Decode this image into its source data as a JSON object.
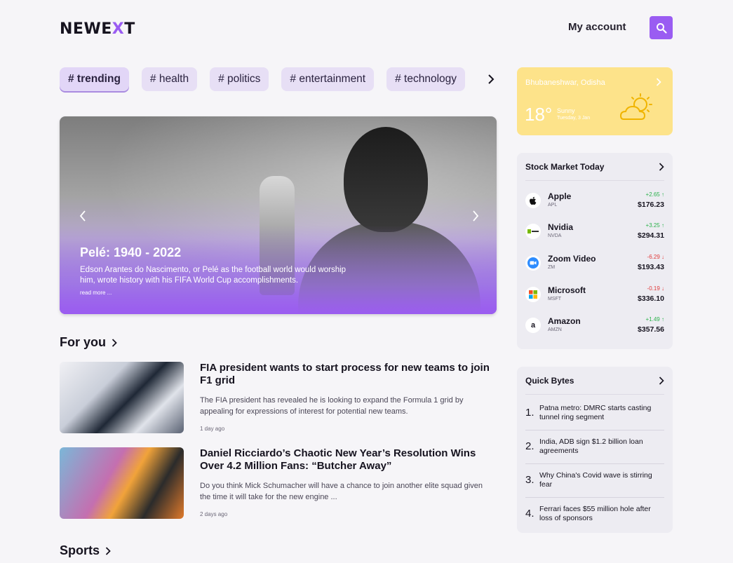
{
  "header": {
    "logo_prefix": "NEWE",
    "logo_accent": "X",
    "logo_suffix": "T",
    "account_label": "My account",
    "accent_color": "#9a5cf2"
  },
  "tags": [
    {
      "label": "# trending",
      "active": true
    },
    {
      "label": "# health"
    },
    {
      "label": "# politics"
    },
    {
      "label": "# entertainment"
    },
    {
      "label": "# technology"
    }
  ],
  "hero": {
    "title": "Pelé: 1940 - 2022",
    "description": "Edson Arantes do Nascimento, or Pelé as the football world would worship him, wrote history with his FIFA World Cup accomplishments.",
    "read_more": "read more ..."
  },
  "for_you": {
    "heading": "For you",
    "articles": [
      {
        "title": "FIA president wants to start process for new teams to join F1 grid",
        "description": "The FIA president has revealed he is looking to expand the Formula 1 grid by appealing for expressions of interest for potential new teams.",
        "time": "1 day ago"
      },
      {
        "title": "Daniel Ricciardo’s Chaotic New Year’s Resolution Wins Over 4.2 Million Fans: “Butcher Away”",
        "description": "Do you think Mick Schumacher will have a chance to join another elite squad given the time it will take for the new engine ...",
        "time": "2 days ago"
      }
    ]
  },
  "sports": {
    "heading": "Sports"
  },
  "weather": {
    "location": "Bhubaneshwar, Odisha",
    "temperature": "18°",
    "condition": "Sunny",
    "date": "Tuesday, 3 Jan"
  },
  "stocks": {
    "title": "Stock Market Today",
    "items": [
      {
        "name": "Apple",
        "symbol": "APL",
        "change": "+2.65",
        "direction": "up",
        "price": "$176.23",
        "icon": "apple-logo-icon",
        "glyph": ""
      },
      {
        "name": "Nvidia",
        "symbol": "NVDA",
        "change": "+3.25",
        "direction": "up",
        "price": "$294.31",
        "icon": "nvidia-logo-icon",
        "glyph": ""
      },
      {
        "name": "Zoom Video",
        "symbol": "ZM",
        "change": "-6.29",
        "direction": "down",
        "price": "$193.43",
        "icon": "zoom-logo-icon",
        "glyph": ""
      },
      {
        "name": "Microsoft",
        "symbol": "MSFT",
        "change": "-0.19",
        "direction": "down",
        "price": "$336.10",
        "icon": "microsoft-logo-icon",
        "glyph": ""
      },
      {
        "name": "Amazon",
        "symbol": "AMZN",
        "change": "+1.49",
        "direction": "up",
        "price": "$357.56",
        "icon": "amazon-logo-icon",
        "glyph": "a"
      }
    ]
  },
  "quick_bytes": {
    "title": "Quick Bytes",
    "items": [
      {
        "num": "1.",
        "text": "Patna metro: DMRC starts casting tunnel ring segment"
      },
      {
        "num": "2.",
        "text": "India, ADB sign $1.2 billion loan agreements"
      },
      {
        "num": "3.",
        "text": "Why China's Covid wave is stirring fear"
      },
      {
        "num": "4.",
        "text": "Ferrari faces $55 million hole after loss of sponsors"
      }
    ]
  }
}
